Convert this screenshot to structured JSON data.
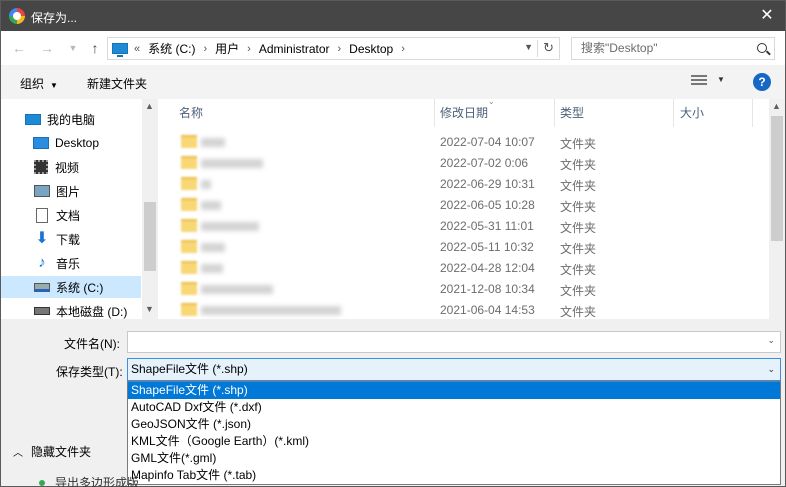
{
  "window": {
    "title": "保存为..."
  },
  "address": {
    "prefix": "«",
    "crumbs": [
      "系统 (C:)",
      "用户",
      "Administrator",
      "Desktop"
    ],
    "search_placeholder": "搜索\"Desktop\""
  },
  "toolbar": {
    "organize": "组织",
    "new_folder": "新建文件夹",
    "help": "?"
  },
  "nav": {
    "items": [
      {
        "label": "我的电脑",
        "icon": "pc-icon"
      },
      {
        "label": "Desktop",
        "icon": "desktop-icon"
      },
      {
        "label": "视频",
        "icon": "video-icon"
      },
      {
        "label": "图片",
        "icon": "picture-icon"
      },
      {
        "label": "文档",
        "icon": "document-icon"
      },
      {
        "label": "下载",
        "icon": "download-icon"
      },
      {
        "label": "音乐",
        "icon": "music-icon"
      },
      {
        "label": "系统 (C:)",
        "icon": "drive-icon"
      },
      {
        "label": "本地磁盘 (D:)",
        "icon": "disk-icon"
      }
    ]
  },
  "list": {
    "columns": {
      "name": "名称",
      "date": "修改日期",
      "type": "类型",
      "size": "大小"
    },
    "rows": [
      {
        "date": "2022-07-04 10:07",
        "type": "文件夹"
      },
      {
        "date": "2022-07-02 0:06",
        "type": "文件夹"
      },
      {
        "date": "2022-06-29 10:31",
        "type": "文件夹"
      },
      {
        "date": "2022-06-05 10:28",
        "type": "文件夹"
      },
      {
        "date": "2022-05-31 11:01",
        "type": "文件夹"
      },
      {
        "date": "2022-05-11 10:32",
        "type": "文件夹"
      },
      {
        "date": "2022-04-28 12:04",
        "type": "文件夹"
      },
      {
        "date": "2021-12-08 10:34",
        "type": "文件夹"
      },
      {
        "date": "2021-06-04 14:53",
        "type": "文件夹"
      }
    ]
  },
  "form": {
    "filename_label": "文件名(N):",
    "filename_value": "",
    "filetype_label": "保存类型(T):",
    "filetype_value": "ShapeFile文件 (*.shp)",
    "options": [
      "ShapeFile文件 (*.shp)",
      "AutoCAD Dxf文件 (*.dxf)",
      "GeoJSON文件 (*.json)",
      "KML文件（Google Earth）(*.kml)",
      "GML文件(*.gml)",
      "Mapinfo Tab文件 (*.tab)"
    ],
    "hide_folders": "隐藏文件夹",
    "background_item": "导出多边形成版"
  }
}
